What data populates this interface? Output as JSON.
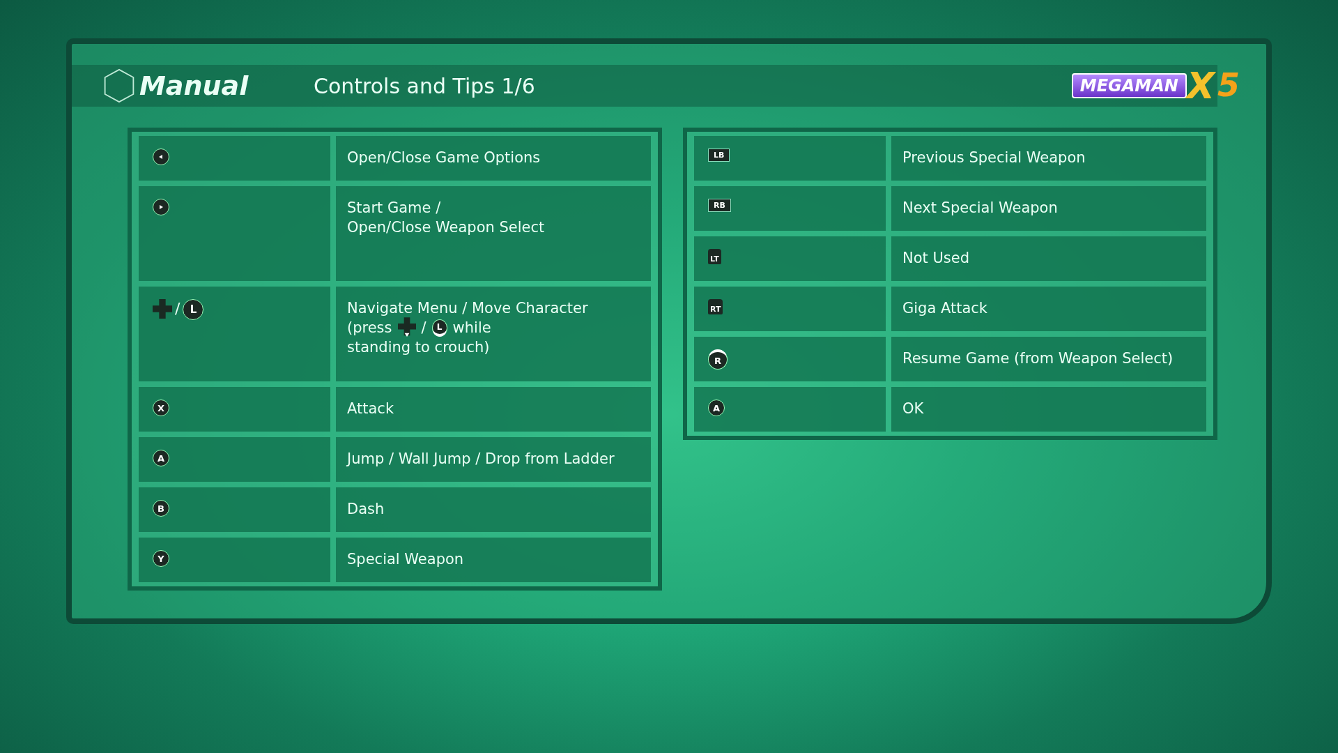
{
  "header": {
    "title": "Manual",
    "subtitle": "Controls and Tips 1/6"
  },
  "logo": {
    "name": "MEGAMAN",
    "mark": "X",
    "number": "5"
  },
  "panels": [
    {
      "rows": [
        {
          "inputs": [
            {
              "kind": "back"
            }
          ],
          "lines": [
            [
              {
                "kind": "text",
                "text": "Open/Close Game Options"
              }
            ]
          ]
        },
        {
          "inputs": [
            {
              "kind": "start"
            }
          ],
          "lines": [
            [
              {
                "kind": "text",
                "text": "Start Game /"
              }
            ],
            [
              {
                "kind": "text",
                "text": "Open/Close Weapon Select"
              }
            ]
          ]
        },
        {
          "inputs": [
            {
              "kind": "dpad"
            },
            {
              "kind": "slash",
              "text": "/"
            },
            {
              "kind": "stick",
              "label": "L"
            }
          ],
          "lines": [
            [
              {
                "kind": "text",
                "text": "Navigate Menu / Move Character"
              }
            ],
            [
              {
                "kind": "text",
                "text": "(press"
              },
              {
                "kind": "dpad-down"
              },
              {
                "kind": "text",
                "text": "/"
              },
              {
                "kind": "stick-down",
                "label": "L"
              },
              {
                "kind": "text",
                "text": "while"
              }
            ],
            [
              {
                "kind": "text",
                "text": "standing to crouch)"
              }
            ]
          ]
        },
        {
          "inputs": [
            {
              "kind": "face",
              "label": "X"
            }
          ],
          "lines": [
            [
              {
                "kind": "text",
                "text": "Attack"
              }
            ]
          ]
        },
        {
          "inputs": [
            {
              "kind": "face",
              "label": "A"
            }
          ],
          "lines": [
            [
              {
                "kind": "text",
                "text": "Jump / Wall Jump / Drop from Ladder"
              }
            ]
          ]
        },
        {
          "inputs": [
            {
              "kind": "face",
              "label": "B"
            }
          ],
          "lines": [
            [
              {
                "kind": "text",
                "text": "Dash"
              }
            ]
          ]
        },
        {
          "inputs": [
            {
              "kind": "face",
              "label": "Y"
            }
          ],
          "lines": [
            [
              {
                "kind": "text",
                "text": "Special Weapon"
              }
            ]
          ]
        }
      ]
    },
    {
      "rows": [
        {
          "inputs": [
            {
              "kind": "bumper",
              "label": "LB"
            }
          ],
          "lines": [
            [
              {
                "kind": "text",
                "text": "Previous Special Weapon"
              }
            ]
          ]
        },
        {
          "inputs": [
            {
              "kind": "bumper",
              "label": "RB"
            }
          ],
          "lines": [
            [
              {
                "kind": "text",
                "text": "Next Special Weapon"
              }
            ]
          ]
        },
        {
          "inputs": [
            {
              "kind": "trigger",
              "label": "LT"
            }
          ],
          "lines": [
            [
              {
                "kind": "text",
                "text": "Not Used"
              }
            ]
          ]
        },
        {
          "inputs": [
            {
              "kind": "trigger",
              "label": "RT"
            }
          ],
          "lines": [
            [
              {
                "kind": "text",
                "text": "Giga Attack"
              }
            ]
          ]
        },
        {
          "inputs": [
            {
              "kind": "stick-press",
              "label": "R"
            }
          ],
          "lines": [
            [
              {
                "kind": "text",
                "text": "Resume Game (from Weapon Select)"
              }
            ]
          ]
        },
        {
          "inputs": [
            {
              "kind": "face",
              "label": "A"
            }
          ],
          "lines": [
            [
              {
                "kind": "text",
                "text": "OK"
              }
            ]
          ]
        }
      ]
    }
  ]
}
